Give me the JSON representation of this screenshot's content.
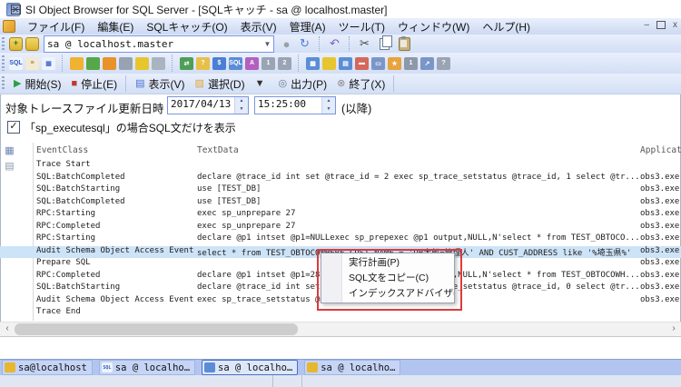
{
  "window": {
    "title": "SI Object Browser for SQL Server - [SQLキャッチ - sa @ localhost.master]"
  },
  "menubar": {
    "items": [
      {
        "label": "ファイル(F)"
      },
      {
        "label": "編集(E)"
      },
      {
        "label": "SQLキャッチ(O)"
      },
      {
        "label": "表示(V)"
      },
      {
        "label": "管理(A)"
      },
      {
        "label": "ツール(T)"
      },
      {
        "label": "ウィンドウ(W)"
      },
      {
        "label": "ヘルプ(H)"
      }
    ]
  },
  "connection": {
    "value": "sa @ localhost.master",
    "dropdown_glyph": "▼"
  },
  "toolbar_icons": [
    {
      "name": "sql-window-icon",
      "glyph": "SQL",
      "bg": "#eef3fc",
      "fg": "#2d5bbf",
      "clickable": "true"
    },
    {
      "name": "script-window-icon",
      "glyph": "≡",
      "bg": "#f2ead2",
      "fg": "#8a7040",
      "clickable": "true"
    },
    {
      "name": "data-grid-icon",
      "glyph": "▦",
      "bg": "#eef3fc",
      "fg": "#4a6fd0",
      "clickable": "true"
    },
    {
      "sep": true
    },
    {
      "name": "session-monitor-icon",
      "glyph": "",
      "bg": "#f0b231",
      "clickable": "true"
    },
    {
      "name": "performance-monitor-icon",
      "glyph": "",
      "bg": "#57a64a",
      "clickable": "true"
    },
    {
      "name": "lock-monitor-icon",
      "glyph": "",
      "bg": "#e8922a",
      "clickable": "true"
    },
    {
      "name": "database-list-icon",
      "glyph": "",
      "bg": "#97a3b2",
      "clickable": "true"
    },
    {
      "name": "storage-icon",
      "glyph": "",
      "bg": "#e6c52f",
      "clickable": "true"
    },
    {
      "name": "job-schedule-icon",
      "glyph": "",
      "bg": "#aab3c0",
      "clickable": "true"
    },
    {
      "sep": true
    },
    {
      "name": "import-icon",
      "glyph": "⇄",
      "bg": "#4f9e57",
      "clickable": "true"
    },
    {
      "name": "export-icon",
      "glyph": "?",
      "bg": "#e6c14a",
      "clickable": "true"
    },
    {
      "name": "dml-monitor-icon",
      "glyph": "$",
      "bg": "#4a7fd4",
      "clickable": "true"
    },
    {
      "name": "sql-catch-icon",
      "glyph": "SQL",
      "bg": "#5b8dd6",
      "clickable": "true"
    },
    {
      "name": "rename-icon",
      "glyph": "A",
      "bg": "#b45fc0",
      "clickable": "true"
    },
    {
      "name": "user-script-1-icon",
      "glyph": "1",
      "bg": "#9aa4b4",
      "clickable": "true"
    },
    {
      "name": "user-script-2-icon",
      "glyph": "2",
      "bg": "#9aa4b4",
      "clickable": "true"
    },
    {
      "sep": true
    },
    {
      "name": "grid-view-icon",
      "glyph": "▦",
      "bg": "#5b8dd6",
      "clickable": "true"
    },
    {
      "name": "key-icon",
      "glyph": "",
      "bg": "#e6c52f",
      "clickable": "true"
    },
    {
      "name": "calendar-icon",
      "glyph": "▤",
      "bg": "#5b8dd6",
      "clickable": "true"
    },
    {
      "name": "window-red-icon",
      "glyph": "▬",
      "bg": "#d4685c",
      "clickable": "true"
    },
    {
      "name": "window-blue-icon",
      "glyph": "▭",
      "bg": "#7a96c8",
      "clickable": "true"
    },
    {
      "name": "window-star-icon",
      "glyph": "★",
      "bg": "#e8a33c",
      "clickable": "true"
    },
    {
      "name": "layers-icon",
      "glyph": "1",
      "bg": "#8d98a8",
      "clickable": "true"
    },
    {
      "name": "popout-window-icon",
      "glyph": "↗",
      "bg": "#7a96c8",
      "clickable": "true"
    },
    {
      "name": "help-window-icon",
      "glyph": "?",
      "bg": "#9aa4b4",
      "clickable": "true"
    }
  ],
  "capture_toolbar": [
    {
      "name": "capture-start-button",
      "glyph": "▶",
      "color": "#2f9e44",
      "label": "開始(S)",
      "clickable": "true"
    },
    {
      "name": "capture-stop-button",
      "glyph": "■",
      "color": "#c0392b",
      "label": "停止(E)",
      "clickable": "true"
    },
    {
      "sep": true
    },
    {
      "name": "capture-view-button",
      "glyph": "▤",
      "color": "#4a6fd0",
      "label": "表示(V)",
      "clickable": "true"
    },
    {
      "name": "capture-select-button",
      "glyph": "▨",
      "color": "#e0a63c",
      "label": "選択(D)",
      "clickable": "true"
    },
    {
      "name": "capture-select-dropdown",
      "glyph": "▼",
      "color": "#333333",
      "label": "",
      "clickable": "true"
    },
    {
      "name": "capture-output-button",
      "glyph": "◎",
      "color": "#6a7a8a",
      "label": "出力(P)",
      "clickable": "true"
    },
    {
      "name": "capture-end-button",
      "glyph": "⊗",
      "color": "#8a8a8a",
      "label": "終了(X)",
      "clickable": "true"
    },
    {
      "sep": true
    }
  ],
  "filter": {
    "label": "対象トレースファイル更新日時",
    "date": "2017/04/13",
    "time": "15:25:00",
    "suffix": "(以降)",
    "checkbox_label": "「sp_executesql」の場合SQL文だけを表示",
    "checkbox_checked": "✓"
  },
  "table": {
    "columns": {
      "event": "EventClass",
      "text": "TextData",
      "app": "ApplicationName"
    },
    "rows": [
      {
        "event": "Trace Start",
        "text": "",
        "app": ""
      },
      {
        "event": "SQL:BatchCompleted",
        "text": "declare @trace_id int set @trace_id = 2 exec sp_trace_setstatus @trace_id, 1 select @tr...",
        "app": "obs3.exe"
      },
      {
        "event": "SQL:BatchStarting",
        "text": "use [TEST_DB]",
        "app": "obs3.exe"
      },
      {
        "event": "SQL:BatchCompleted",
        "text": "use [TEST_DB]",
        "app": "obs3.exe"
      },
      {
        "event": "RPC:Starting",
        "text": "exec sp_unprepare 27",
        "app": "obs3.exe"
      },
      {
        "event": "RPC:Completed",
        "text": "exec sp_unprepare 27",
        "app": "obs3.exe"
      },
      {
        "event": "RPC:Starting",
        "text": "declare @p1 intset @p1=NULLexec sp_prepexec @p1 output,NULL,N'select * from TEST_OBTOCO...",
        "app": "obs3.exe"
      },
      {
        "event": "Audit Schema Object Access Event",
        "text": "select * from TEST_OBTOCOWHERE CUST_NAME = 'OB太郎=管理人' AND CUST_ADDRESS like '%埼玉県%'",
        "app": "obs3.exe",
        "selected": true
      },
      {
        "event": "Prepare SQL",
        "text": "",
        "app": "obs3.exe"
      },
      {
        "event": "RPC:Completed",
        "text": "declare @p1 intset @p1=28exec sp_prepexec @p1 output,NULL,N'select * from TEST_OBTOCOWH...",
        "app": "obs3.exe"
      },
      {
        "event": "SQL:BatchStarting",
        "text": "declare @trace_id int set @trace_id = 2 exec sp_trace_setstatus @trace_id, 0 select @tr...",
        "app": "obs3.exe"
      },
      {
        "event": "Audit Schema Object Access Event",
        "text": "exec sp_trace_setstatus @trace_id, 0",
        "app": "obs3.exe"
      },
      {
        "event": "Trace End",
        "text": "",
        "app": ""
      }
    ]
  },
  "context_menu": {
    "items": [
      {
        "label": "実行計画(P)"
      },
      {
        "label": "SQL文をコピー(C)"
      },
      {
        "label": "インデックスアドバイザ(I)"
      }
    ]
  },
  "scrollbar": {
    "left_arrow": "‹",
    "right_arrow": "›"
  },
  "taskbar": [
    {
      "name": "task-button-sa-localhost",
      "label": "sa@localhost",
      "glyph": "",
      "glyph_bg": "#e6b82f"
    },
    {
      "name": "task-button-sql-window",
      "label": "sa @ localho…",
      "glyph": "SQL",
      "glyph_bg": "#eef3fc"
    },
    {
      "name": "task-button-sql-catch",
      "label": "sa @ localho…",
      "glyph": "",
      "glyph_bg": "#5b8dd6",
      "active": true
    },
    {
      "name": "task-button-object-window",
      "label": "sa @ localho…",
      "glyph": "",
      "glyph_bg": "#e6b82f"
    }
  ],
  "colors": {
    "selection": "#cde3f8",
    "annotation_red": "#dd3b3b",
    "toolbar_bg": "#dde6f7",
    "mdibar_bg": "#b1c5f0"
  }
}
